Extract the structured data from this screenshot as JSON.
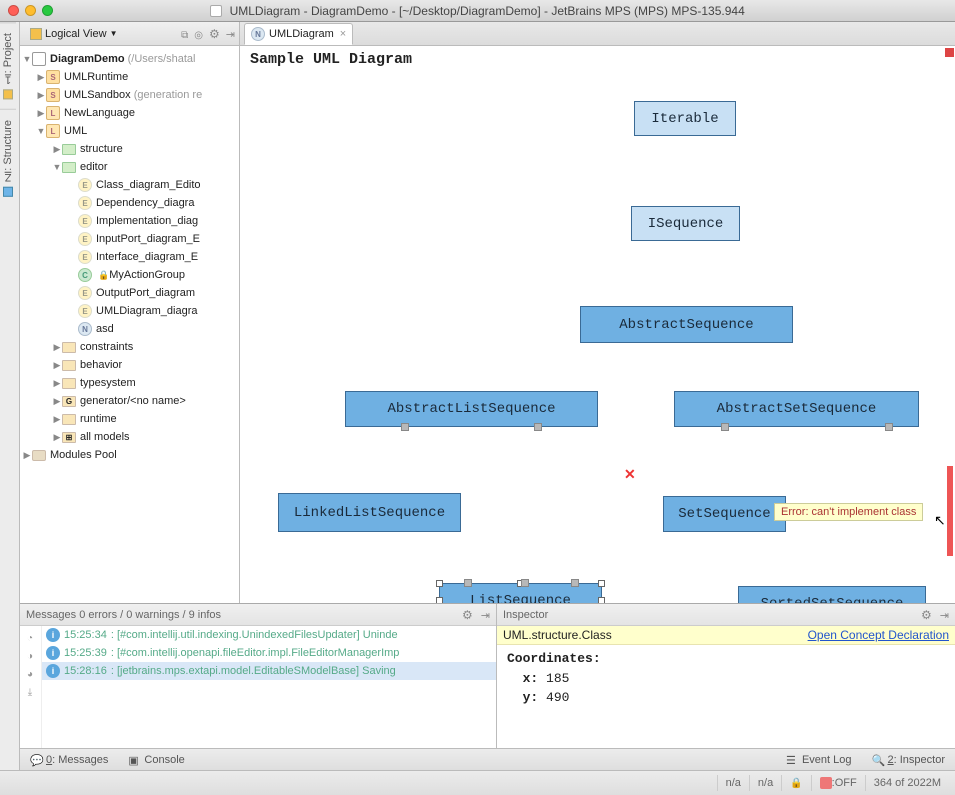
{
  "titlebar": {
    "title": "UMLDiagram - DiagramDemo - [~/Desktop/DiagramDemo] - JetBrains MPS (MPS) MPS-135.944"
  },
  "left_gutter": {
    "tabs": [
      {
        "num": "1",
        "label": "Project"
      },
      {
        "num": "Z",
        "label": "Structure"
      }
    ]
  },
  "project_panel": {
    "view_label": "Logical View",
    "root": {
      "label": "DiagramDemo",
      "suffix": "(/Users/shatal"
    },
    "nodes": {
      "umlruntime": "UMLRuntime",
      "umlsandbox": "UMLSandbox",
      "umlsandbox_suffix": "(generation re",
      "newlanguage": "NewLanguage",
      "uml": "UML",
      "structure": "structure",
      "editor": "editor",
      "class_diagram": "Class_diagram_Edito",
      "dependency": "Dependency_diagra",
      "implementation": "Implementation_diag",
      "inputport": "InputPort_diagram_E",
      "interface": "Interface_diagram_E",
      "myaction": "MyActionGroup",
      "outputport": "OutputPort_diagram",
      "umldiagram": "UMLDiagram_diagra",
      "asd": "asd",
      "constraints": "constraints",
      "behavior": "behavior",
      "typesystem": "typesystem",
      "generator": "generator/<no name>",
      "runtime": "runtime",
      "allmodels": "all models",
      "modulespool": "Modules Pool"
    }
  },
  "editor": {
    "tab_label": "UMLDiagram",
    "diagram_title": "Sample UML Diagram",
    "boxes": {
      "iterable": "Iterable",
      "isequence": "ISequence",
      "abstractseq": "AbstractSequence",
      "abstractlistseq": "AbstractListSequence",
      "abstractsetseq": "AbstractSetSequence",
      "linkedlistseq": "LinkedListSequence",
      "setseq": "SetSequence",
      "listseq": "ListSequence",
      "sortedsetseq": "SortedSetSequence"
    },
    "error_tooltip": "Error: can't implement class"
  },
  "messages_panel": {
    "header": "Messages 0 errors / 0 warnings / 9 infos",
    "rows": [
      {
        "time": "15:25:34",
        "text": "[#com.intellij.util.indexing.UnindexedFilesUpdater] Uninde"
      },
      {
        "time": "15:25:39",
        "text": "[#com.intellij.openapi.fileEditor.impl.FileEditorManagerImp"
      },
      {
        "time": "15:28:16",
        "text": "[jetbrains.mps.extapi.model.EditableSModelBase] Saving "
      }
    ]
  },
  "inspector_panel": {
    "header": "Inspector",
    "class_line": "UML.structure.Class",
    "open_decl": "Open Concept Declaration",
    "coords_label": "Coordinates:",
    "x_label": "x:",
    "x_val": "185",
    "y_label": "y:",
    "y_val": "490"
  },
  "bottom_tabs": {
    "messages_num": "0",
    "messages": "Messages",
    "console": "Console",
    "event_log": "Event Log",
    "inspector_num": "2",
    "inspector": "Inspector"
  },
  "statusbar": {
    "na1": "n/a",
    "na2": "n/a",
    "off": ":OFF",
    "mem": "364 of 2022M"
  }
}
